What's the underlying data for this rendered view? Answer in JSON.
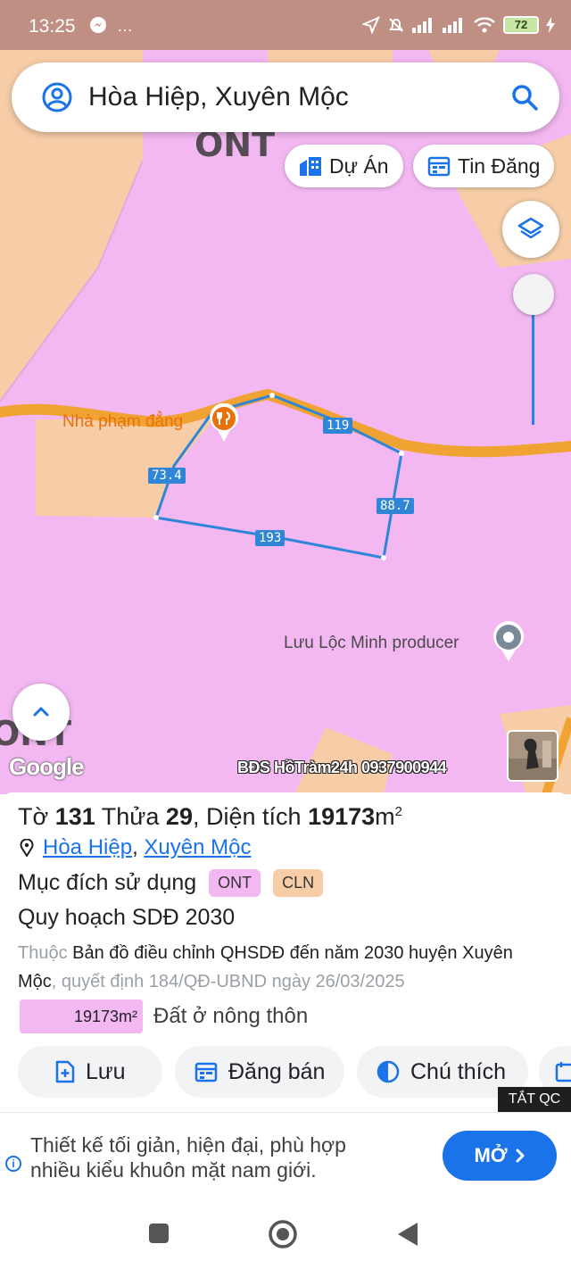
{
  "status_bar": {
    "time": "13:25",
    "left_icons": "…",
    "battery": "72"
  },
  "search": {
    "query": "Hòa Hiệp, Xuyên Mộc"
  },
  "map": {
    "zone_labels": [
      "ONT",
      "ONT"
    ],
    "chips": {
      "du_an": "Dự Án",
      "tin_dang": "Tin Đăng"
    },
    "parcel_edges": [
      "119",
      "73.4",
      "88.7",
      "193"
    ],
    "poi": {
      "restaurant": "Nhà phạm đẳng",
      "producer": "Lưu Lộc Minh producer"
    },
    "google": "Google",
    "watermark": "BĐS HồTràm24h 0937900944",
    "colors": {
      "ont_zone": "#f3b8f2",
      "cln_zone": "#f6cda7",
      "road": "#f0a233",
      "parcel": "#2f86d6"
    }
  },
  "parcel": {
    "to_label": "Tờ",
    "to_value": "131",
    "thua_label": "Thửa",
    "thua_value": "29",
    "area_label": "Diện tích",
    "area_value": "19173",
    "area_unit": "m",
    "location": {
      "ward": "Hòa Hiệp",
      "district": "Xuyên Mộc"
    },
    "purpose_label": "Mục đích sử dụng",
    "purpose_tags": [
      "ONT",
      "CLN"
    ],
    "plan_title": "Quy hoạch SDĐ 2030",
    "plan_prefix": "Thuộc",
    "plan_name": "Bản đồ điều chỉnh QHSDĐ đến năm 2030 huyện Xuyên Mộc",
    "plan_decision": ", quyết định 184/QĐ-UBND ngày 26/03/2025",
    "area_chip": "19173m²",
    "area_type": "Đất ở nông thôn"
  },
  "actions": {
    "save": "Lưu",
    "sell": "Đăng bán",
    "legend": "Chú thích"
  },
  "tat_qc": "TẮT QC",
  "ad": {
    "line1": "Thiết kế tối giản, hiện đại, phù hợp",
    "line2": "nhiều kiểu khuôn mặt nam giới.",
    "button": "MỞ"
  }
}
